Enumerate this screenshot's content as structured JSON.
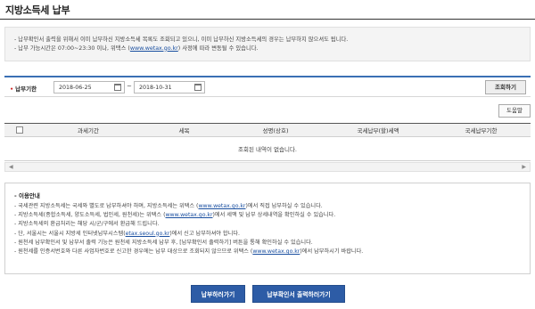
{
  "page": {
    "title": "지방소득세 납부"
  },
  "notice": {
    "line1": "- 납부확인서 출력을 위해서 이미 납부하신 지방소득세 목록도 조회되고 있으니, 이미 납부하신 지방소득세의 경우는 납부하지 않으셔도 됩니다.",
    "line2_pre": "- 납부 가능시간은 07:00~23:30 이나, 위택스 (",
    "line2_link": "www.wetax.go.kr",
    "line2_post": ") 사정에 따라 변동될 수 있습니다."
  },
  "search": {
    "label": "납부기한",
    "start_date": "2018-06-25",
    "tilde": "~",
    "end_date": "2018-10-31",
    "button": "조회하기"
  },
  "help_button": "도움말",
  "table": {
    "headers": [
      "",
      "과세기간",
      "세목",
      "성명(상호)",
      "국세납부(할)세액",
      "국세납부기한"
    ],
    "empty_message": "조회된 내역이 없습니다."
  },
  "scroll": {
    "left": "◀",
    "right": "▶"
  },
  "guide": {
    "title": "- 이용안내",
    "l1_pre": "- 국세관련 지방소득세는 국세와 별도로 납부하셔야 하며, 지방소득세는 위택스 (",
    "l1_link": "www.wetax.go.kr",
    "l1_post": ")에서 직접 납부하실 수 있습니다.",
    "l2_pre": "- 지방소득세(종합소득세, 양도소득세, 법인세, 원천세)는 위택스 (",
    "l2_link": "www.wetax.go.kr",
    "l2_post": ")에서 세액 및 납부 상세내역을 확인하실 수 있습니다.",
    "l3": "- 지방소득세의 환급처리는 해당 시/군/구에서 환급해 드립니다.",
    "l4_pre": "- 단, 서울시는 서울시 지방세 인터넷납부시스템(",
    "l4_link": "etax.seoul.go.kr",
    "l4_post": ")에서 신고 납부하셔야 합니다.",
    "l5": "- 원천세 납부확인서 및 납부서 출력 기능은 원천세 지방소득세 납부 후, [납부확인서 출력하기] 버튼을 통해 확인하실 수 있습니다.",
    "l6_pre": "- 원천세를 인증서번호와 다른 사업자번호로 신고한 경우에는 납부 대상으로 조회되지 않으므로 위택스 (",
    "l6_link": "www.wetax.go.kr",
    "l6_post": ")에서 납부하시기 바랍니다."
  },
  "buttons": {
    "pay": "납부하러가기",
    "print": "납부확인서 출력하러가기"
  },
  "colors": {
    "accent": "#2d5ca6",
    "link": "#1a4fa0",
    "required": "#d02a2a"
  }
}
